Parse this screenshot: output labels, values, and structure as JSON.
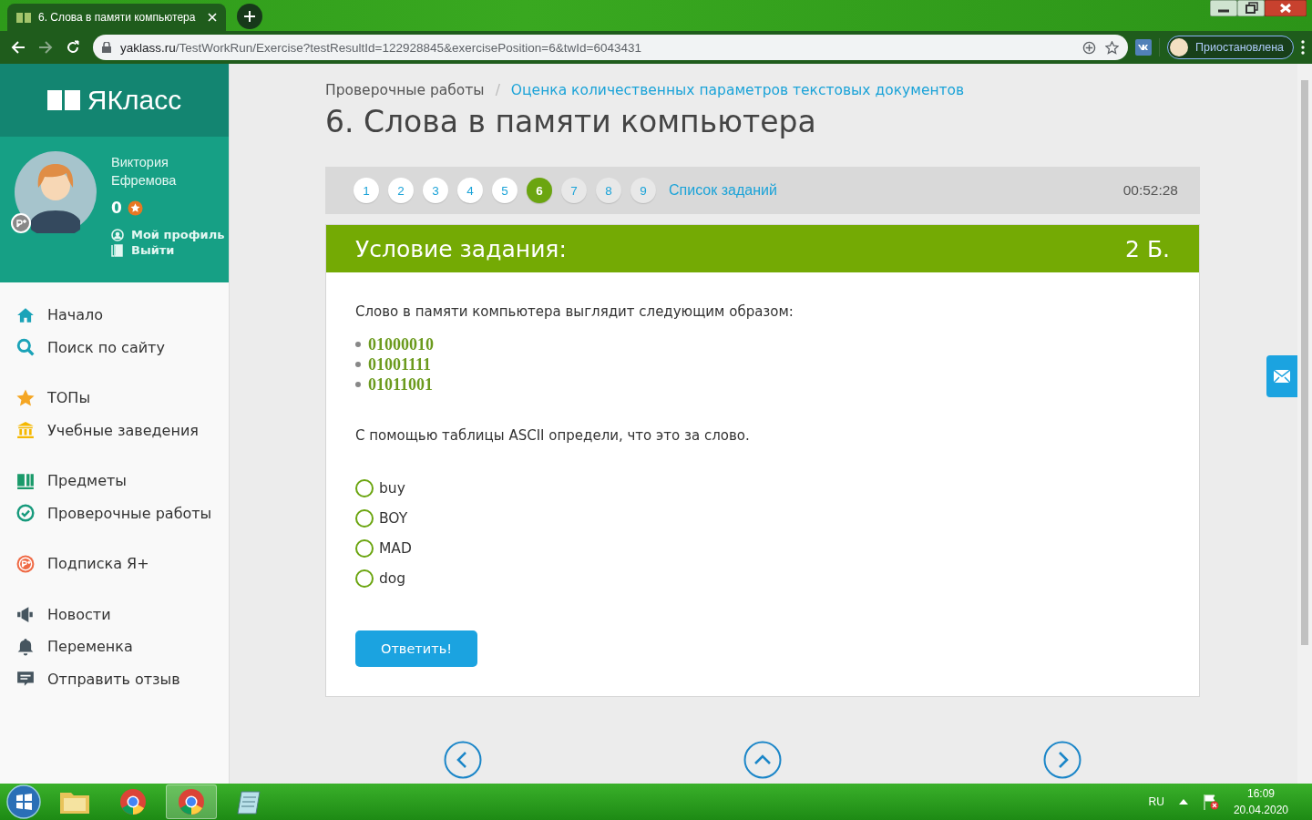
{
  "browser": {
    "tab_title": "6. Слова в памяти компьютера",
    "url_host": "yaklass.ru",
    "url_path": "/TestWorkRun/Exercise?testResultId=122928845&exercisePosition=6&twId=6043431",
    "profile_label": "Приостановлена"
  },
  "sidebar": {
    "logo": "ЯКласс",
    "user": {
      "name": "Виктория Ефремова",
      "score": "0",
      "links": [
        {
          "label": "Мой профиль",
          "kind": "profile"
        },
        {
          "label": "Выйти",
          "kind": "logout"
        }
      ]
    },
    "menu": [
      [
        {
          "label": "Начало",
          "kind": "home"
        },
        {
          "label": "Поиск по сайту",
          "kind": "search"
        }
      ],
      [
        {
          "label": "ТОПы",
          "kind": "star"
        },
        {
          "label": "Учебные заведения",
          "kind": "school"
        }
      ],
      [
        {
          "label": "Предметы",
          "kind": "books"
        },
        {
          "label": "Проверочные работы",
          "kind": "check"
        }
      ],
      [
        {
          "label": "Подписка Я+",
          "kind": "plus"
        }
      ],
      [
        {
          "label": "Новости",
          "kind": "news"
        },
        {
          "label": "Переменка",
          "kind": "bell"
        },
        {
          "label": "Отправить отзыв",
          "kind": "feedback"
        }
      ]
    ]
  },
  "main": {
    "breadcrumbs": [
      {
        "label": "Проверочные работы",
        "kind": "text"
      },
      {
        "label": "Оценка количественных параметров текстовых документов",
        "kind": "link"
      }
    ],
    "separator": "/",
    "title": "6. Слова в памяти компьютера",
    "task_nav": {
      "items": [
        {
          "label": "1",
          "selected": false,
          "visited": true
        },
        {
          "label": "2",
          "selected": false,
          "visited": true
        },
        {
          "label": "3",
          "selected": false,
          "visited": true
        },
        {
          "label": "4",
          "selected": false,
          "visited": true
        },
        {
          "label": "5",
          "selected": false,
          "visited": true
        },
        {
          "label": "6",
          "selected": true,
          "visited": true
        },
        {
          "label": "7",
          "selected": false,
          "visited": false
        },
        {
          "label": "8",
          "selected": false,
          "visited": false
        },
        {
          "label": "9",
          "selected": false,
          "visited": false
        }
      ],
      "list_link": "Список заданий",
      "timer": "00:52:28"
    },
    "task": {
      "header": "Условие задания:",
      "points": "2 Б.",
      "question": "Слово в памяти компьютера выглядит следующим образом:",
      "codes": [
        "01000010",
        "01001111",
        "01011001"
      ],
      "instruction": "С помощью таблицы ASCII определи, что это за слово.",
      "options": [
        {
          "label": "buy",
          "selected": false
        },
        {
          "label": "BOY",
          "selected": false
        },
        {
          "label": "MAD",
          "selected": false
        },
        {
          "label": "dog",
          "selected": false
        }
      ],
      "submit": "Ответить!"
    }
  },
  "taskbar": {
    "language": "RU",
    "time": "16:09",
    "date": "20.04.2020"
  }
}
